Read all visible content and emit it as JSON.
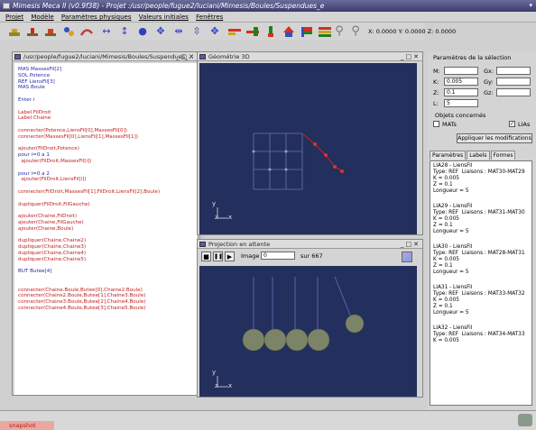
{
  "window": {
    "title": "Mimesis Meca II (v0.9f38) - Projet :/usr/people/fugue2/luciani/Mimesis/Boules/Suspendues_e"
  },
  "menu": [
    "Projet",
    "Modèle",
    "Paramètres physiques",
    "Valeurs initiales",
    "Fenêtres"
  ],
  "coords": "X: 0.0000 Y: 0.0000 Z: 0.0000",
  "editor": {
    "title": "/usr/people/fugue2/luciani/Mimesis/Boules/Suspendues_...",
    "lines": [
      {
        "t": "MAS MassesFil[2]",
        "c": "b"
      },
      {
        "t": "SOL Potence",
        "c": "b"
      },
      {
        "t": "REF LiensFil[3]",
        "c": "b"
      },
      {
        "t": "MAS Boule",
        "c": "b"
      },
      {
        "t": "",
        "c": "b"
      },
      {
        "t": "Enter i",
        "c": "b"
      },
      {
        "t": "",
        "c": "b"
      },
      {
        "t": "Label FilDroit",
        "c": "r"
      },
      {
        "t": "Label Chaine",
        "c": "r"
      },
      {
        "t": "",
        "c": "b"
      },
      {
        "t": "connecter(Potence,LiensFil[0],MassesFil[0])",
        "c": "r"
      },
      {
        "t": "connecter(MassesFil[0],LiensFil[1],MassesFil[1])",
        "c": "r"
      },
      {
        "t": "",
        "c": "b"
      },
      {
        "t": "ajouter(FilDroit,Potence)",
        "c": "r"
      },
      {
        "t": "pour i=0 a 1",
        "c": "b"
      },
      {
        "t": "  ajouter(FilDroit,MassesFil[i])",
        "c": "r"
      },
      {
        "t": "",
        "c": "b"
      },
      {
        "t": "pour i=0 a 2",
        "c": "b"
      },
      {
        "t": "  ajouter(FilDroit,LiensFil[i])",
        "c": "r"
      },
      {
        "t": "",
        "c": "b"
      },
      {
        "t": "connecter(FilDroit,MassesFil[1],FilDroit,LiensFil[2],Boule)",
        "c": "r"
      },
      {
        "t": "",
        "c": "b"
      },
      {
        "t": "dupliquer(FilDroit,FilGauche)",
        "c": "r"
      },
      {
        "t": "",
        "c": "b"
      },
      {
        "t": "ajouter(Chaine,FilDroit)",
        "c": "r"
      },
      {
        "t": "ajouter(Chaine,FilGauche)",
        "c": "r"
      },
      {
        "t": "ajouter(Chaine,Boule)",
        "c": "r"
      },
      {
        "t": "",
        "c": "b"
      },
      {
        "t": "dupliquer(Chaine,Chaine2)",
        "c": "r"
      },
      {
        "t": "dupliquer(Chaine,Chaine3)",
        "c": "r"
      },
      {
        "t": "dupliquer(Chaine,Chaine4)",
        "c": "r"
      },
      {
        "t": "dupliquer(Chaine,Chaine5)",
        "c": "r"
      },
      {
        "t": "",
        "c": "b"
      },
      {
        "t": "BUT Butee[4]",
        "c": "b"
      },
      {
        "t": "",
        "c": "b"
      },
      {
        "t": "",
        "c": "b"
      },
      {
        "t": "connecter(Chaine.Boule,Butee[0],Chaine2.Boule)",
        "c": "r"
      },
      {
        "t": "connecter(Chaine2.Boule,Butee[1],Chaine3.Boule)",
        "c": "r"
      },
      {
        "t": "connecter(Chaine3.Boule,Butee[2],Chaine4.Boule)",
        "c": "r"
      },
      {
        "t": "connecter(Chaine4.Boule,Butee[3],Chaine5.Boule)",
        "c": "r"
      }
    ]
  },
  "geo3d": {
    "title": "Géométrie 3D",
    "axis_y": "y",
    "axis_z": "z",
    "axis_x": "x"
  },
  "projection": {
    "title": "Projection en attente",
    "image_label": "Image",
    "image_value": "0",
    "sur": "sur 667",
    "axis_y": "y",
    "axis_z": "z",
    "axis_x": "x"
  },
  "side": {
    "title": "Paramètres de la sélection",
    "M_label": "M:",
    "M_value": "",
    "K_label": "K:",
    "K_value": "0.005",
    "Z_label": "Z:",
    "Z_value": "0.1",
    "L_label": "L:",
    "L_value": "5",
    "Gx_label": "Gx:",
    "Gy_label": "Gy:",
    "Gz_label": "Gz:",
    "concernes": "Objets concernés",
    "mats": "MATs",
    "lias": "LIAs",
    "apply": "Appliquer les modifications",
    "tabs": [
      "Paramètres",
      "Labels",
      "Formes"
    ],
    "entries": [
      {
        "name": "LIA28 - LiensFil",
        "type": "Type: REF  Liaisons : MAT30-MAT29",
        "k": "K = 0.005",
        "z": "Z = 0.1",
        "l": "Longueur = 5"
      },
      {
        "name": "LIA29 - LiensFil",
        "type": "Type: REF  Liaisons : MAT31-MAT30",
        "k": "K = 0.005",
        "z": "Z = 0.1",
        "l": "Longueur = 5"
      },
      {
        "name": "LIA30 - LiensFil",
        "type": "Type: REF  Liaisons : MAT28-MAT31",
        "k": "K = 0.005",
        "z": "Z = 0.1",
        "l": "Longueur = 5"
      },
      {
        "name": "LIA31 - LiensFil",
        "type": "Type: REF  Liaisons : MAT33-MAT32",
        "k": "K = 0.005",
        "z": "Z = 0.1",
        "l": "Longueur = 5"
      },
      {
        "name": "LIA32 - LiensFil",
        "type": "Type: REF  Liaisons : MAT34-MAT33",
        "k": "K = 0.005",
        "z": "",
        "l": ""
      }
    ]
  },
  "status": {
    "snapshot": "snapshot"
  }
}
